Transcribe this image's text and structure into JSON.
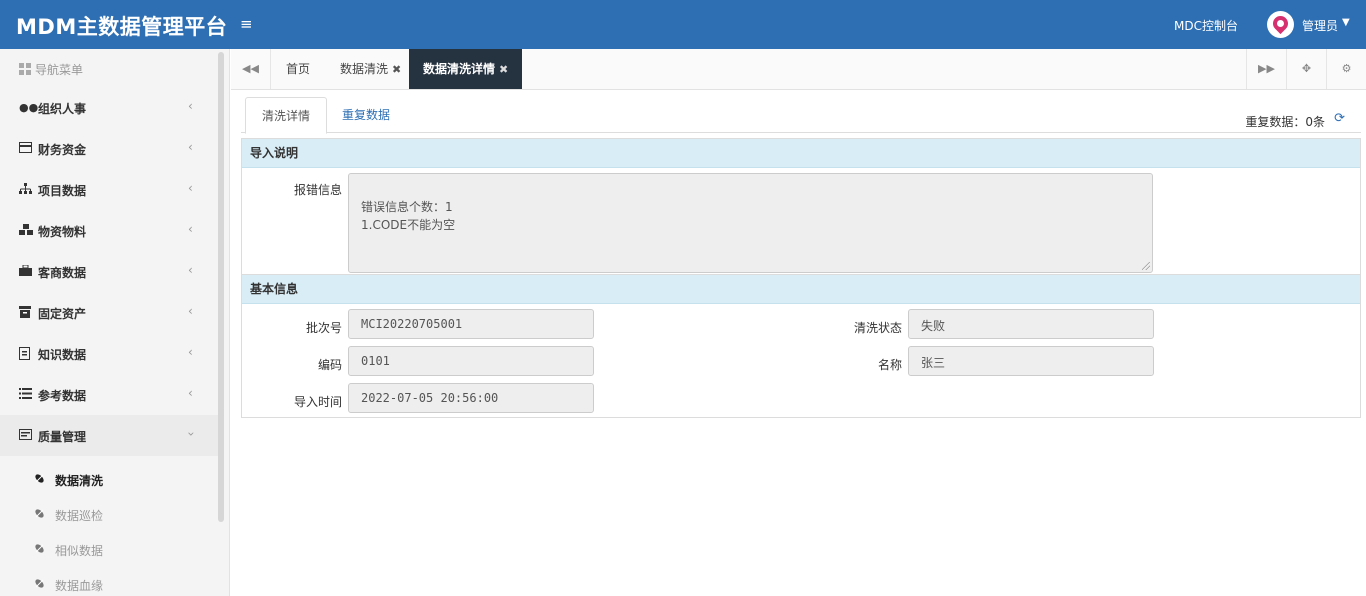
{
  "app": {
    "title": "MDM主数据管理平台",
    "console_link": "MDC控制台",
    "user_name": "管理员"
  },
  "sidebar": {
    "header": "导航菜单",
    "items": [
      {
        "label": "组织人事",
        "icon": "users-icon"
      },
      {
        "label": "财务资金",
        "icon": "card-icon"
      },
      {
        "label": "项目数据",
        "icon": "sitemap-icon"
      },
      {
        "label": "物资物料",
        "icon": "cubes-icon"
      },
      {
        "label": "客商数据",
        "icon": "briefcase-icon"
      },
      {
        "label": "固定资产",
        "icon": "archive-icon"
      },
      {
        "label": "知识数据",
        "icon": "file-icon"
      },
      {
        "label": "参考数据",
        "icon": "list-icon"
      },
      {
        "label": "质量管理",
        "icon": "quality-icon"
      }
    ],
    "sub_items": [
      {
        "label": "数据清洗",
        "active": true
      },
      {
        "label": "数据巡检"
      },
      {
        "label": "相似数据"
      },
      {
        "label": "数据血缘"
      }
    ]
  },
  "tabs": {
    "home": "首页",
    "clean": "数据清洗",
    "detail": "数据清洗详情"
  },
  "inner_tabs": {
    "detail": "清洗详情",
    "duplicate": "重复数据"
  },
  "duplicate_count": "重复数据：0条",
  "import_section": {
    "title": "导入说明",
    "error_label": "报错信息",
    "error_text": "错误信息个数：1\n1.CODE不能为空"
  },
  "basic_section": {
    "title": "基本信息",
    "batch_label": "批次号",
    "batch_value": "MCI20220705001",
    "status_label": "清洗状态",
    "status_value": "失败",
    "code_label": "编码",
    "code_value": "0101",
    "name_label": "名称",
    "name_value": "张三",
    "time_label": "导入时间",
    "time_value": "2022-07-05 20:56:00"
  }
}
